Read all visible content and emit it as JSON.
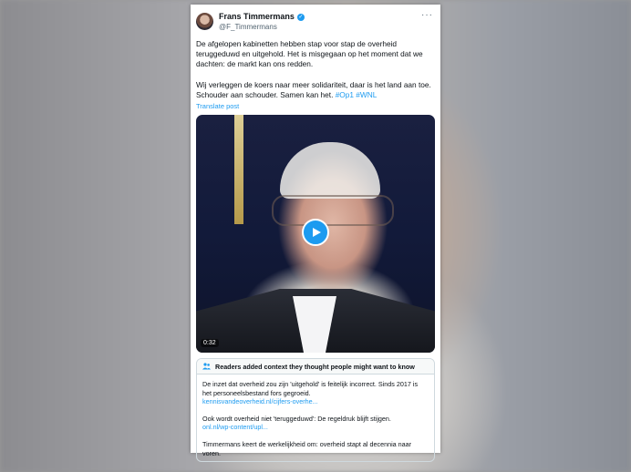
{
  "post": {
    "author_name": "Frans Timmermans",
    "handle": "@F_Timmermans",
    "more_glyph": "···",
    "paragraph1": "De afgelopen kabinetten hebben stap voor stap de overheid teruggeduwd en uitgehold. Het is misgegaan op het moment dat we dachten: de markt kan ons redden.",
    "paragraph2_text": "Wij verleggen de koers naar meer solidariteit, daar is het land aan toe. Schouder aan schouder. Samen kan het.",
    "hashtag1": "#Op1",
    "hashtag2": "#WNL",
    "translate_label": "Translate post"
  },
  "video": {
    "duration": "0:32"
  },
  "community_note": {
    "title": "Readers added context they thought people might want to know",
    "item1_text": "De inzet dat overheid zou zijn 'uitgehold' is feitelijk incorrect. Sinds 2017 is het personeelsbestand fors gegroeid.",
    "item1_link": "kennisvandeoverheid.nl/cijfers-overhe...",
    "item2_text": "Ook wordt overheid niet 'teruggeduwd': De regeldruk blijft stijgen.",
    "item2_link": "onl.nl/wp-content/upl...",
    "item3_text": "Timmermans keert de werkelijkheid om: overheid stapt al decennia naar voren."
  },
  "colors": {
    "accent": "#1d9bf0",
    "text": "#0f1419",
    "muted": "#536471"
  }
}
